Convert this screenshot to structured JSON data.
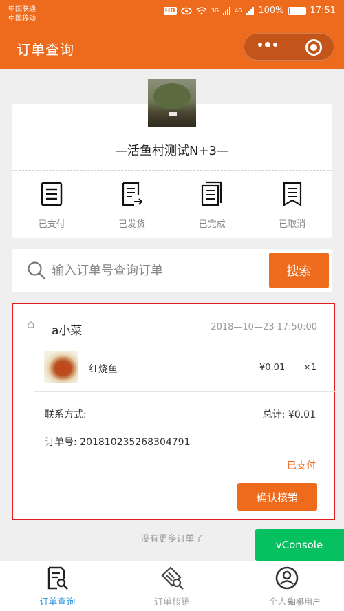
{
  "status_bar": {
    "carrier_1": "中国联通",
    "carrier_2": "中国移动",
    "hd": "HD",
    "net_1": "3G",
    "net_2": "4G",
    "battery": "100%",
    "time": "17:51"
  },
  "header": {
    "title": "订单查询"
  },
  "store": {
    "name": "—活鱼村测试N+3—"
  },
  "status_tabs": [
    {
      "label": "已支付",
      "icon": "paid-receipt-icon"
    },
    {
      "label": "已发货",
      "icon": "shipped-document-icon"
    },
    {
      "label": "已完成",
      "icon": "completed-document-icon"
    },
    {
      "label": "已取消",
      "icon": "cancelled-bookmark-icon"
    }
  ],
  "search": {
    "placeholder": "输入订单号查询订单",
    "button_label": "搜索"
  },
  "order": {
    "shop_name": "a小菜",
    "time": "2018—10—23  17:50:00",
    "item": {
      "name": "红烧鱼",
      "price": "¥0.01",
      "qty": "×1"
    },
    "contact_label": "联系方式:",
    "total": "总计: ¥0.01",
    "order_no": "订单号: 201810235268304791",
    "status": "已支付",
    "confirm_label": "确认核销"
  },
  "no_more": "———没有更多订单了———",
  "vconsole": "vConsole",
  "tab_bar": [
    {
      "label": "订单查询",
      "icon": "order-search-icon",
      "active": true
    },
    {
      "label": "订单核销",
      "icon": "order-verify-icon",
      "active": false
    },
    {
      "label": "个人中心",
      "icon": "profile-icon",
      "active": false
    }
  ],
  "watermark": "知乎用户",
  "colors": {
    "accent": "#ee6a1c",
    "active_tab": "#3a9be0",
    "highlight_border": "#e21c1c",
    "vconsole": "#07c160"
  }
}
